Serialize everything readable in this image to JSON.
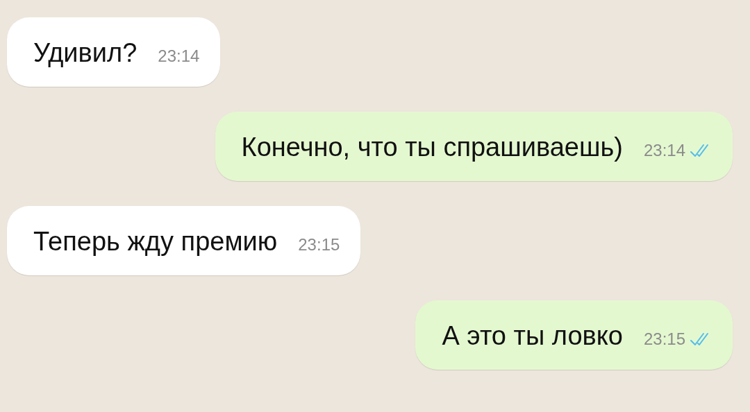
{
  "messages": [
    {
      "kind": "incoming",
      "text": "Удивил?",
      "time": "23:14"
    },
    {
      "kind": "outgoing",
      "text": "Конечно, что ты спрашиваешь)",
      "time": "23:14",
      "read": true
    },
    {
      "kind": "incoming",
      "text": "Теперь жду премию",
      "time": "23:15"
    },
    {
      "kind": "outgoing",
      "text": "А это ты ловко",
      "time": "23:15",
      "read": true
    }
  ]
}
